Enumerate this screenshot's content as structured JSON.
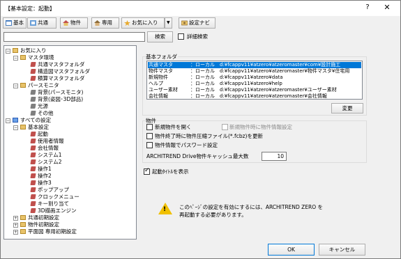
{
  "window": {
    "title": "【基本設定：起動】",
    "help_label": "?",
    "close_label": "✕"
  },
  "toolbar": {
    "basic": "基本",
    "common": "共通",
    "property": "物件",
    "dedicated": "専用",
    "favorites": "お気に入り",
    "dropdown_arrow": "▼",
    "setup_navi": "設定ナビ"
  },
  "search": {
    "value": "",
    "button_label": "検索",
    "detail_search_label": "詳細検索"
  },
  "tree": {
    "favorites": "お気に入り",
    "master_env": "マスタ環境",
    "common_master_folder": "共通マスタフォルダ",
    "structure_master_folder": "構造図マスタフォルダ",
    "fitting_master_folder": "積算マスタフォルダ",
    "perspective_monitor": "パースモニタ",
    "bg_perspective": "背景(パースモニタ)",
    "bg_3d": "背景(姿図･3D部品)",
    "light_source": "光源",
    "other": "その他",
    "all_settings": "すべての設定",
    "basic_settings": "基本設定",
    "startup": "起動",
    "user_info": "使用者情報",
    "company_info": "会社情報",
    "system1": "システム1",
    "system2": "システム2",
    "operation1": "操作1",
    "operation2": "操作2",
    "operation3": "操作3",
    "popup": "ポップアップ",
    "click_menu": "クロックメニュー",
    "key_assign": "キー割り当て",
    "render_engine": "3D描画エンジン",
    "common_initial": "共通初期設定",
    "property_initial": "物件初期設定",
    "floorplan_initial": "平面図 専用初期設定"
  },
  "basic_folder": {
    "label": "基本フォルダ",
    "rows": [
      {
        "name": "共通マスタ",
        "type": "：ローカル",
        "path": "d:¥fcappv11¥atzero¥atzeromaster¥com¥設計施工"
      },
      {
        "name": "物件マスタ",
        "type": "：ローカル",
        "path": "d:¥fcappv11¥atzero¥atzeromaster¥物件マスタ¥住宅用"
      },
      {
        "name": "新規物件",
        "type": "：ローカル",
        "path": "d:¥fcappv11¥atzero¥data"
      },
      {
        "name": "ヘルプ",
        "type": "：ローカル",
        "path": "d:¥fcappv11¥atzero¥help"
      },
      {
        "name": "ユーザー素材",
        "type": "：ローカル",
        "path": "d:¥fcappv11¥atzero¥atzeromaster¥ユーザー素材"
      },
      {
        "name": "会社情報",
        "type": "：ローカル",
        "path": "d:¥fcappv11¥atzero¥atzeromaster¥会社情報"
      }
    ],
    "change_button": "変更"
  },
  "property_group": {
    "label": "物件",
    "open_new_label": "新規物件を開く",
    "open_new_checked": false,
    "new_info_label": "新規物件時に物件情報設定",
    "new_info_checked": false,
    "update_zip_label": "物件終了時に物件圧縮ファイル(*.fcbz)を更新",
    "update_zip_checked": false,
    "password_label": "物件情報でパスワード設定",
    "password_checked": false,
    "cache_label": "ARCHITREND Drive物件キャッシュ最大数",
    "cache_value": "10"
  },
  "startup_title": {
    "label": "起動ﾀｲﾄﾙを表示",
    "checked": true
  },
  "notice": {
    "line1": "このﾍﾟｰｼﾞの設定を有効にするには、ARCHITREND ZERO を",
    "line2": "再起動する必要があります。"
  },
  "footer": {
    "ok": "OK",
    "cancel": "キャンセル"
  }
}
